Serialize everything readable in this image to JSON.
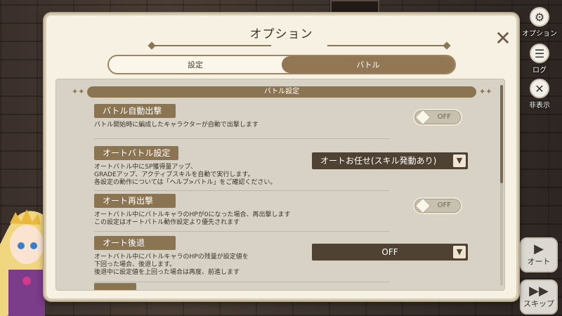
{
  "dialog": {
    "title": "オプション",
    "close_icon": "close-x-icon"
  },
  "tabs": [
    {
      "label": "設定",
      "active": false
    },
    {
      "label": "バトル",
      "active": true
    }
  ],
  "section": {
    "title": "バトル設定"
  },
  "settings": [
    {
      "label": "バトル自動出撃",
      "description": "バトル開始時に編成したキャラクターが自動で出撃します",
      "control": "toggle",
      "value": "OFF"
    },
    {
      "label": "オートバトル設定",
      "description": "オートバトル中にSP獲得量アップ、\nGRADEアップ、アクティブスキルを自動で実行します。\n各設定の動作については「ヘルプ>バトル」をご確認ください。",
      "control": "dropdown",
      "value": "オートお任せ(スキル発動あり)"
    },
    {
      "label": "オート再出撃",
      "description": "オートバトル中にバトルキャラのHPが0になった場合、再出撃します\nこの設定はオートバトル動作設定より優先されます",
      "control": "toggle",
      "value": "OFF"
    },
    {
      "label": "オート後退",
      "description": "オートバトル中にバトルキャラのHPの残量が設定値を\n下回った場合、後退します。\n後退中に設定値を上回った場合は再度、前進します",
      "control": "dropdown",
      "value": "OFF"
    }
  ],
  "side_menu": [
    {
      "label": "オプション",
      "icon": "gear-icon"
    },
    {
      "label": "ログ",
      "icon": "log-icon"
    },
    {
      "label": "非表示",
      "icon": "hide-icon"
    }
  ],
  "battle_buttons": [
    {
      "label": "オート",
      "icon": "play-icon"
    },
    {
      "label": "スキップ",
      "icon": "fast-forward-icon"
    }
  ],
  "colors": {
    "accent_brown": "#8b7452",
    "dialog_bg": "#f7f1e3",
    "panel_bg": "#d8d2c6",
    "dropdown_bg": "#4f4232"
  }
}
